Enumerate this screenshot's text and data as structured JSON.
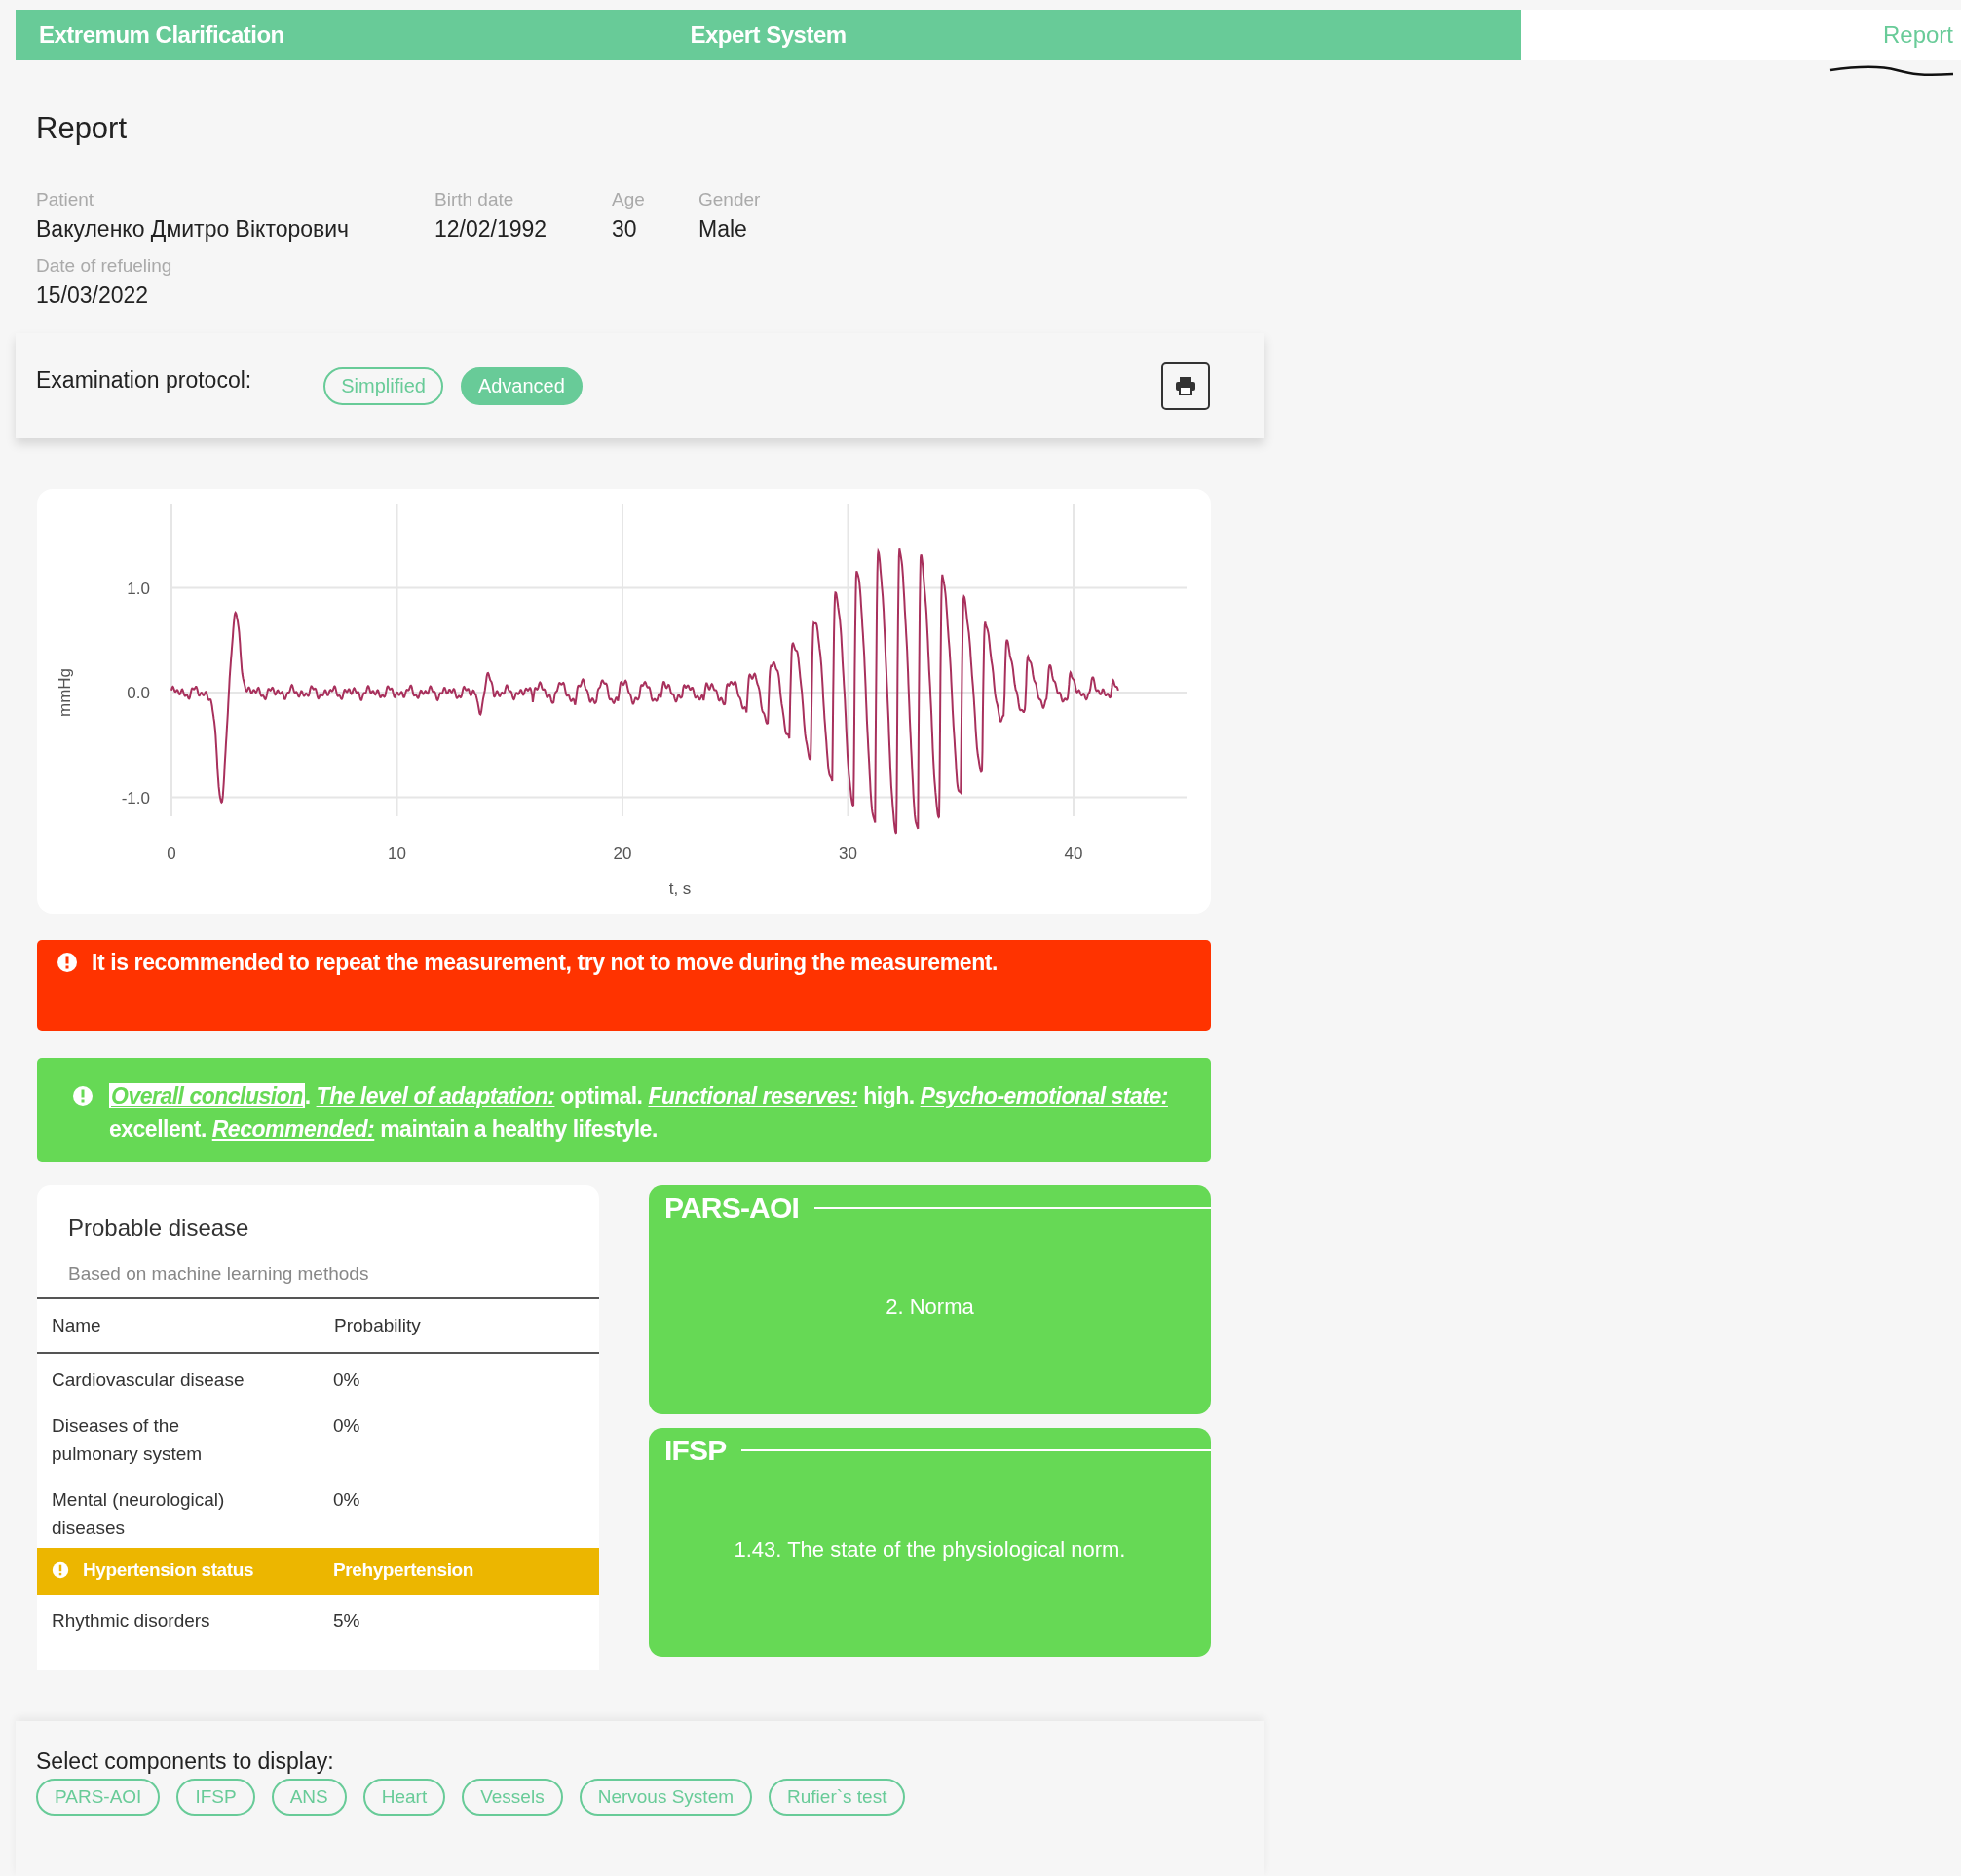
{
  "top_bar": {
    "brand": "Extremum Clarification",
    "title": "Expert System",
    "report_link": "Report"
  },
  "heading": "Report",
  "patient": {
    "fields": [
      {
        "label": "Patient",
        "value": "Вакуленко Дмитро Вікторович"
      },
      {
        "label": "Birth date",
        "value": "12/02/1992"
      },
      {
        "label": "Age",
        "value": "30"
      },
      {
        "label": "Gender",
        "value": "Male"
      }
    ],
    "refueling": {
      "label": "Date of refueling",
      "value": "15/03/2022"
    }
  },
  "protocol": {
    "label": "Examination protocol:",
    "options": [
      {
        "label": "Simplified",
        "selected": false
      },
      {
        "label": "Advanced",
        "selected": true
      }
    ]
  },
  "chart": {
    "ylabel": "mmHg",
    "xlabel": "t, s",
    "xticks": [
      "0",
      "10",
      "20",
      "30",
      "40"
    ],
    "yticks": [
      "1.0",
      "0.0",
      "-1.0"
    ]
  },
  "alert": {
    "text": "It is recommended to repeat the measurement, try not to move during the measurement."
  },
  "conclusion": {
    "segments": [
      {
        "kind": "link",
        "text": "Overall conclusion",
        "highlighted": true
      },
      {
        "kind": "text",
        "text": ". "
      },
      {
        "kind": "link",
        "text": "The level of adaptation:",
        "highlighted": false
      },
      {
        "kind": "text",
        "text": " optimal. "
      },
      {
        "kind": "link",
        "text": "Functional reserves:",
        "highlighted": false
      },
      {
        "kind": "text",
        "text": " high. "
      },
      {
        "kind": "link",
        "text": "Psycho-emotional state:",
        "highlighted": false
      },
      {
        "kind": "text",
        "text": " excellent. "
      },
      {
        "kind": "link",
        "text": "Recommended:",
        "highlighted": false
      },
      {
        "kind": "text",
        "text": " maintain a healthy lifestyle."
      }
    ]
  },
  "disease": {
    "title": "Probable disease",
    "subtitle": "Based on machine learning methods",
    "columns": [
      "Name",
      "Probability"
    ],
    "rows": [
      {
        "kind": "normal",
        "name": "Cardiovascular disease",
        "probability": "0%"
      },
      {
        "kind": "normal",
        "name": "Diseases of the pulmonary system",
        "probability": "0%"
      },
      {
        "kind": "normal",
        "name": "Mental (neurological) diseases",
        "probability": "0%"
      },
      {
        "kind": "warning",
        "name": "Hypertension status",
        "probability": "Prehypertension"
      },
      {
        "kind": "normal",
        "name": "Rhythmic disorders",
        "probability": "5%"
      }
    ]
  },
  "scores": [
    {
      "title": "PARS-AOI",
      "value": "2. Norma"
    },
    {
      "title": "IFSP",
      "value": "1.43. The state of the physiological norm."
    }
  ],
  "components": {
    "label": "Select components to display:",
    "options": [
      {
        "label": "PARS-AOI",
        "selected": false
      },
      {
        "label": "IFSP",
        "selected": false
      },
      {
        "label": "ANS",
        "selected": false
      },
      {
        "label": "Heart",
        "selected": false
      },
      {
        "label": "Vessels",
        "selected": false
      },
      {
        "label": "Nervous System",
        "selected": false
      },
      {
        "label": "Rufier`s test",
        "selected": false
      }
    ]
  }
}
